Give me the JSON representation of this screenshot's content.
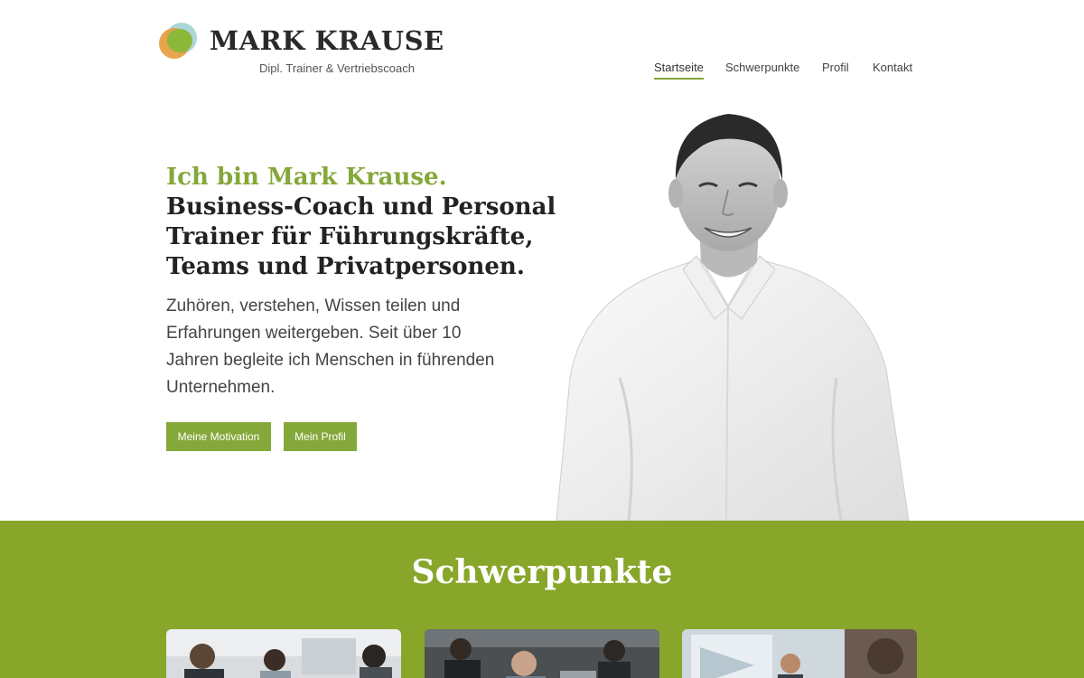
{
  "brand": {
    "name": "MARK KRAUSE",
    "subtitle": "Dipl. Trainer & Vertriebscoach",
    "colors": {
      "accent": "#84a83a",
      "section_bg": "#88a62a",
      "logo_blue": "#9ecfd0",
      "logo_orange": "#e79a3b",
      "logo_green": "#8bb838"
    }
  },
  "nav": {
    "items": [
      {
        "label": "Startseite",
        "active": true
      },
      {
        "label": "Schwerpunkte",
        "active": false
      },
      {
        "label": "Profil",
        "active": false
      },
      {
        "label": "Kontakt",
        "active": false
      }
    ]
  },
  "hero": {
    "title_accent": "Ich bin Mark Krause.",
    "title_rest": "Business-Coach und Personal Trainer für Führungskräfte, Teams und Privatpersonen.",
    "text": "Zuhören, verstehen, Wissen teilen und Erfahrungen weitergeben. Seit über 10 Jahren begleite ich Menschen in führenden Unternehmen.",
    "buttons": {
      "motivation": "Meine Motivation",
      "profile": "Mein Profil"
    }
  },
  "section": {
    "title": "Schwerpunkte",
    "cards": [
      {
        "icon": "team-workshop-photo"
      },
      {
        "icon": "office-meeting-photo"
      },
      {
        "icon": "presentation-photo"
      }
    ]
  }
}
